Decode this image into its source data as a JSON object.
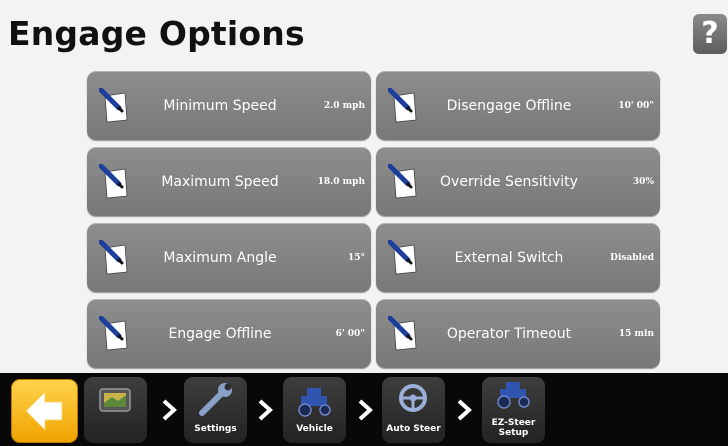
{
  "page": {
    "title": "Engage Options",
    "help_label": "?"
  },
  "options": [
    {
      "label": "Minimum Speed",
      "value": "2.0 mph"
    },
    {
      "label": "Disengage Offline",
      "value": "10' 00\""
    },
    {
      "label": "Maximum Speed",
      "value": "18.0 mph"
    },
    {
      "label": "Override Sensitivity",
      "value": "30%"
    },
    {
      "label": "Maximum Angle",
      "value": "15°"
    },
    {
      "label": "External Switch",
      "value": "Disabled"
    },
    {
      "label": "Engage Offline",
      "value": "6' 00\""
    },
    {
      "label": "Operator Timeout",
      "value": "15 min"
    }
  ],
  "nav": {
    "settings": "Settings",
    "vehicle": "Vehicle",
    "auto_steer": "Auto Steer",
    "ez_steer": "EZ-Steer",
    "ez_steer_sub": "Setup"
  },
  "icons": {
    "tile": "edit-notepad-icon",
    "back": "arrow-left-icon",
    "home": "display-icon",
    "settings": "wrench-icon",
    "vehicle": "tractor-icon",
    "auto_steer": "steering-wheel-icon",
    "ez_steer": "tractor-icon"
  },
  "colors": {
    "back_button": "#f5b800",
    "tile": "#838383",
    "bar": "#080808"
  }
}
